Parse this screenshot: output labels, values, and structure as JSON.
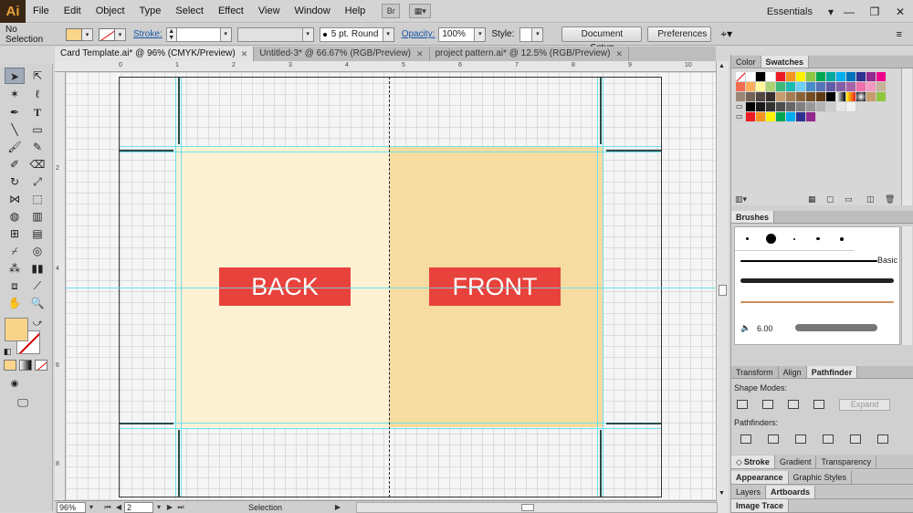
{
  "app": {
    "logo": "Ai",
    "menu": [
      "File",
      "Edit",
      "Object",
      "Type",
      "Select",
      "Effect",
      "View",
      "Window",
      "Help"
    ],
    "bridge_btn": "Br",
    "workspace": "Essentials"
  },
  "control": {
    "selection": "No Selection",
    "stroke_label": "Stroke:",
    "brush": "5 pt. Round",
    "opacity_label": "Opacity:",
    "opacity": "100%",
    "style_label": "Style:",
    "doc_setup": "Document Setup",
    "preferences": "Preferences",
    "fill_color": "#f9d58a",
    "stroke_color": "#ffffff"
  },
  "tabs": [
    {
      "label": "Card Template.ai* @ 96% (CMYK/Preview)"
    },
    {
      "label": "Untitled-3* @ 66.67% (RGB/Preview)"
    },
    {
      "label": "project pattern.ai* @ 12.5% (RGB/Preview)"
    }
  ],
  "rulers": {
    "top": [
      "0",
      "1",
      "2",
      "3",
      "4",
      "5",
      "6",
      "7",
      "8",
      "9",
      "10"
    ],
    "left": [
      "2",
      "4",
      "6",
      "8"
    ]
  },
  "artboard": {
    "back_label": "BACK",
    "front_label": "FRONT",
    "back_color": "#fdf1d4",
    "front_color": "#f6dca0",
    "label_color": "#e8423c"
  },
  "status": {
    "zoom": "96%",
    "artboard_num": "2",
    "tool": "Selection"
  },
  "panels": {
    "color_tab": "Color",
    "swatches_tab": "Swatches",
    "brushes_title": "Brushes",
    "brush_basic": "Basic",
    "brush_size": "6.00",
    "transform_tab": "Transform",
    "align_tab": "Align",
    "pathfinder_tab": "Pathfinder",
    "shape_modes": "Shape Modes:",
    "expand": "Expand",
    "pathfinders": "Pathfinders:",
    "stroke_tab": "Stroke",
    "gradient_tab": "Gradient",
    "transparency_tab": "Transparency",
    "appearance_tab": "Appearance",
    "graphic_styles_tab": "Graphic Styles",
    "layers_tab": "Layers",
    "artboards_tab": "Artboards",
    "image_trace_tab": "Image Trace"
  }
}
